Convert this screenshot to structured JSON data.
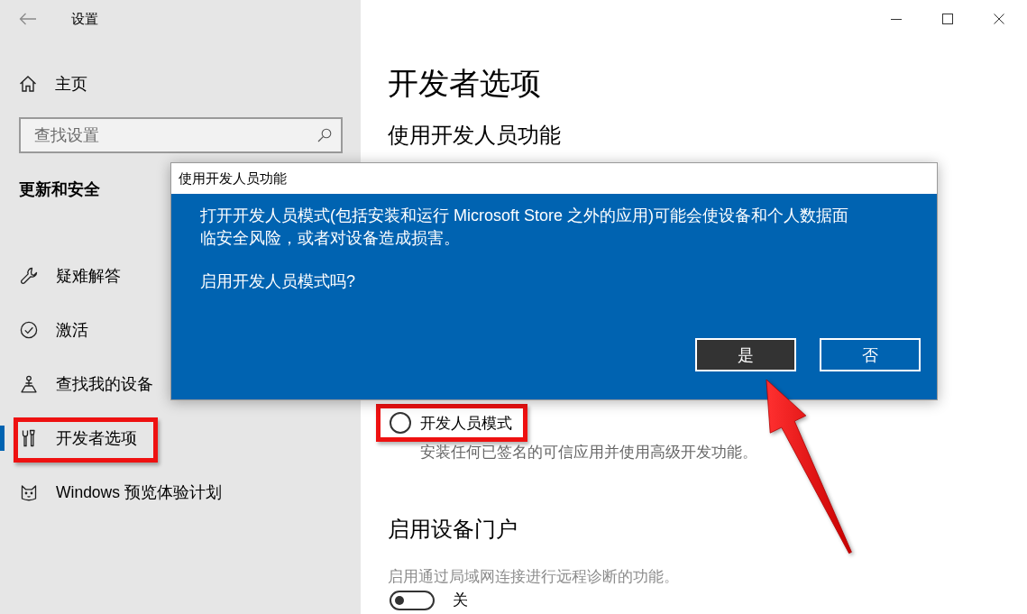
{
  "window": {
    "title": "设置"
  },
  "sidebar": {
    "home": {
      "label": "主页"
    },
    "search": {
      "placeholder": "查找设置"
    },
    "section_title": "更新和安全",
    "items": [
      {
        "label": "疑难解答",
        "selected": false,
        "highlighted": false
      },
      {
        "label": "激活",
        "selected": false,
        "highlighted": false
      },
      {
        "label": "查找我的设备",
        "selected": false,
        "highlighted": false
      },
      {
        "label": "开发者选项",
        "selected": true,
        "highlighted": true
      },
      {
        "label": "Windows 预览体验计划",
        "selected": false,
        "highlighted": false
      }
    ]
  },
  "page": {
    "title": "开发者选项",
    "section_title": "使用开发人员功能",
    "options": [
      {
        "label": "开发人员模式",
        "description": "安装任何已签名的可信应用并使用高级开发功能。",
        "selected": false,
        "highlighted": true
      }
    ],
    "device_portal": {
      "title": "启用设备门户",
      "description": "启用通过局域网连接进行远程诊断的功能。",
      "toggle": {
        "on": false,
        "label": "关"
      }
    }
  },
  "dialog": {
    "title": "使用开发人员功能",
    "paragraphs": [
      "打开开发人员模式(包括安装和运行 Microsoft Store 之外的应用)可能会使设备和个人数据面临安全风险，或者对设备造成损害。",
      "启用开发人员模式吗?"
    ],
    "buttons": [
      {
        "label": "是",
        "focused": true,
        "pointed_at": true
      },
      {
        "label": "否",
        "focused": false,
        "pointed_at": false
      }
    ]
  }
}
